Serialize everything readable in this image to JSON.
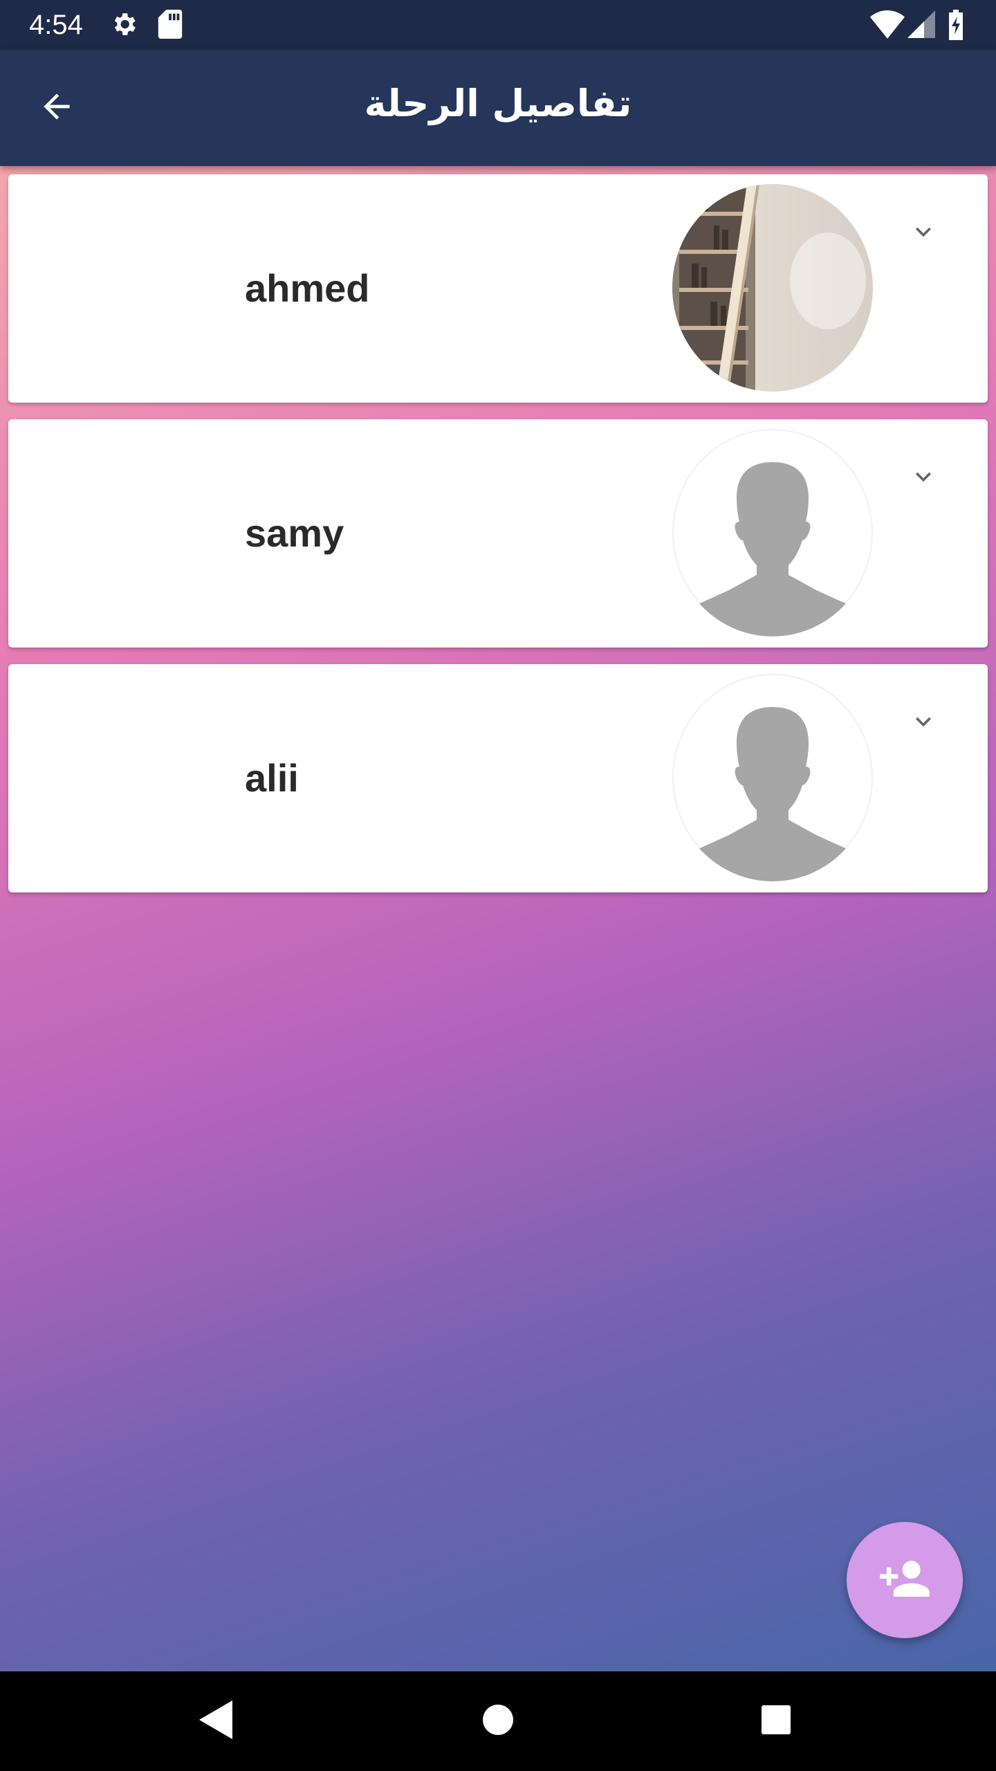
{
  "status_bar": {
    "time": "4:54",
    "icons": [
      "gear-icon",
      "sd-card-icon",
      "wifi-icon",
      "signal-icon",
      "battery-charging-icon"
    ]
  },
  "app_bar": {
    "title": "تفاصيل الرحلة",
    "back_icon": "arrow-back-icon"
  },
  "members": [
    {
      "name": "ahmed",
      "avatar": "photo-bookshelf"
    },
    {
      "name": "samy",
      "avatar": "default-person-silhouette"
    },
    {
      "name": "alii",
      "avatar": "default-person-silhouette"
    }
  ],
  "fab": {
    "icon": "person-add-icon",
    "color": "#d49be8"
  },
  "nav_bar": {
    "icons": [
      "back-triangle-icon",
      "home-circle-icon",
      "recents-square-icon"
    ]
  },
  "colors": {
    "status_bar": "#1e2a47",
    "app_bar": "#25365a",
    "gradient": [
      "#f3a7ad",
      "#e57bb6",
      "#b563bd",
      "#7062b0",
      "#4966a8"
    ]
  }
}
